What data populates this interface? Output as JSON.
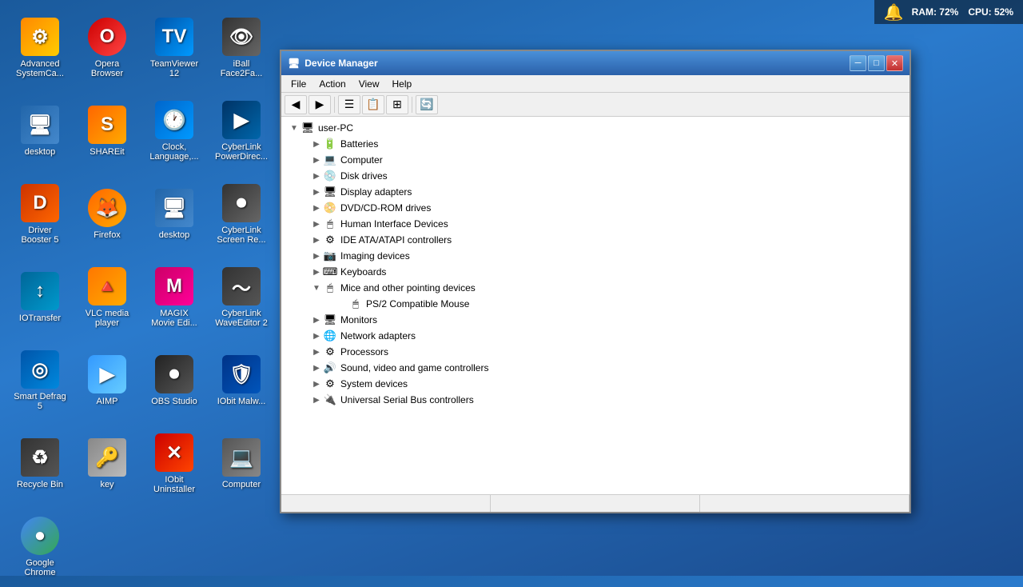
{
  "systemTray": {
    "ram": "RAM: 72%",
    "cpu": "CPU: 52%"
  },
  "desktop": {
    "icons": [
      {
        "id": "advanced-systemcare",
        "label": "Advanced\nSystemCa...",
        "style": "ic-advsys",
        "symbol": "⚙"
      },
      {
        "id": "opera-browser",
        "label": "Opera\nBrowser",
        "style": "ic-opera",
        "symbol": "O"
      },
      {
        "id": "teamviewer",
        "label": "TeamViewer\n12",
        "style": "ic-teamviewer",
        "symbol": "TV"
      },
      {
        "id": "iball",
        "label": "iBall\nFace2Fa...",
        "style": "ic-iball",
        "symbol": "👁"
      },
      {
        "id": "desktop1",
        "label": "desktop",
        "style": "ic-desktop",
        "symbol": "🖥"
      },
      {
        "id": "shareit",
        "label": "SHAREit",
        "style": "ic-shareit",
        "symbol": "S"
      },
      {
        "id": "clock",
        "label": "Clock,\nLanguage,...",
        "style": "ic-clock",
        "symbol": "🕐"
      },
      {
        "id": "cyberlinkpd",
        "label": "CyberLink\nPowerDirec...",
        "style": "ic-cyberlink",
        "symbol": "▶"
      },
      {
        "id": "driverbooster",
        "label": "Driver\nBooster 5",
        "style": "ic-driver",
        "symbol": "D"
      },
      {
        "id": "firefox",
        "label": "Firefox",
        "style": "ic-firefox",
        "symbol": "🦊"
      },
      {
        "id": "desktop2",
        "label": "desktop",
        "style": "ic-desktop",
        "symbol": "🖥"
      },
      {
        "id": "cyberlinksr",
        "label": "CyberLink\nScreen Re...",
        "style": "ic-cyberscreen",
        "symbol": "⏺"
      },
      {
        "id": "iotransfer",
        "label": "IOTransfer",
        "style": "ic-iotransfer",
        "symbol": "↕"
      },
      {
        "id": "vlc",
        "label": "VLC media\nplayer",
        "style": "ic-vlc",
        "symbol": "🔺"
      },
      {
        "id": "magix",
        "label": "MAGIX\nMovie Edi...",
        "style": "ic-magix",
        "symbol": "M"
      },
      {
        "id": "wavedit",
        "label": "CyberLink\nWaveEditor 2",
        "style": "ic-wavedit",
        "symbol": "〜"
      },
      {
        "id": "smartdefrag",
        "label": "Smart Defrag\n5",
        "style": "ic-smartdefrag",
        "symbol": "◎"
      },
      {
        "id": "aimp",
        "label": "AIMP",
        "style": "ic-aimp",
        "symbol": "▶"
      },
      {
        "id": "obs",
        "label": "OBS Studio",
        "style": "ic-obs",
        "symbol": "⏺"
      },
      {
        "id": "iobit",
        "label": "IObit Malw...",
        "style": "ic-iobit",
        "symbol": "🛡"
      },
      {
        "id": "recycle",
        "label": "Recycle Bin",
        "style": "ic-recycle",
        "symbol": "♻"
      },
      {
        "id": "key",
        "label": "key",
        "style": "ic-key",
        "symbol": "🔑"
      },
      {
        "id": "iouninstall",
        "label": "IObit\nUninstaller",
        "style": "ic-iouninstall",
        "symbol": "✕"
      },
      {
        "id": "computer",
        "label": "Computer",
        "style": "ic-computer",
        "symbol": "💻"
      },
      {
        "id": "chrome",
        "label": "Google\nChrome",
        "style": "ic-chrome",
        "symbol": "●"
      }
    ]
  },
  "deviceManager": {
    "title": "Device Manager",
    "menus": [
      "File",
      "Action",
      "View",
      "Help"
    ],
    "computerName": "user-PC",
    "treeItems": [
      {
        "label": "Batteries",
        "icon": "🔋",
        "indent": 1,
        "expanded": false,
        "children": []
      },
      {
        "label": "Computer",
        "icon": "💻",
        "indent": 1,
        "expanded": false,
        "children": []
      },
      {
        "label": "Disk drives",
        "icon": "💿",
        "indent": 1,
        "expanded": false,
        "children": []
      },
      {
        "label": "Display adapters",
        "icon": "🖥",
        "indent": 1,
        "expanded": false,
        "children": []
      },
      {
        "label": "DVD/CD-ROM drives",
        "icon": "💿",
        "indent": 1,
        "expanded": false,
        "children": []
      },
      {
        "label": "Human Interface Devices",
        "icon": "🖱",
        "indent": 1,
        "expanded": false,
        "children": []
      },
      {
        "label": "IDE ATA/ATAPI controllers",
        "icon": "⚙",
        "indent": 1,
        "expanded": false,
        "children": []
      },
      {
        "label": "Imaging devices",
        "icon": "📷",
        "indent": 1,
        "expanded": false,
        "children": []
      },
      {
        "label": "Keyboards",
        "icon": "⌨",
        "indent": 1,
        "expanded": false,
        "children": []
      },
      {
        "label": "Mice and other pointing devices",
        "icon": "🖱",
        "indent": 1,
        "expanded": true,
        "children": [
          {
            "label": "PS/2 Compatible Mouse",
            "icon": "🖱",
            "indent": 2,
            "expanded": false,
            "children": []
          }
        ]
      },
      {
        "label": "Monitors",
        "icon": "🖥",
        "indent": 1,
        "expanded": false,
        "children": []
      },
      {
        "label": "Network adapters",
        "icon": "🌐",
        "indent": 1,
        "expanded": false,
        "children": []
      },
      {
        "label": "Processors",
        "icon": "⚙",
        "indent": 1,
        "expanded": false,
        "children": []
      },
      {
        "label": "Sound, video and game controllers",
        "icon": "🔊",
        "indent": 1,
        "expanded": false,
        "children": []
      },
      {
        "label": "System devices",
        "icon": "⚙",
        "indent": 1,
        "expanded": false,
        "children": []
      },
      {
        "label": "Universal Serial Bus controllers",
        "icon": "🔌",
        "indent": 1,
        "expanded": false,
        "children": []
      }
    ]
  }
}
